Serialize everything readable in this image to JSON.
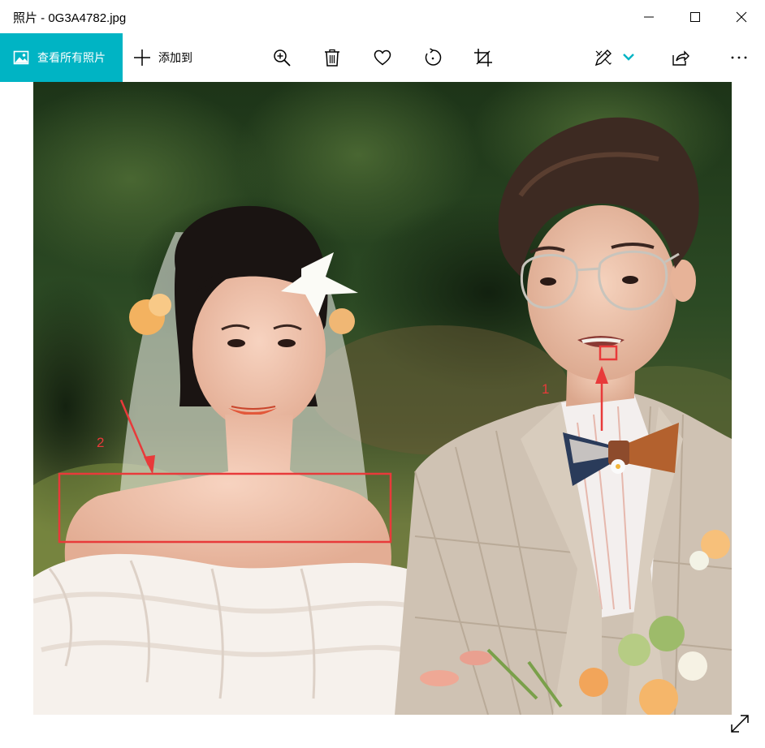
{
  "window": {
    "title": "照片 - 0G3A4782.jpg",
    "controls": [
      "minimize-icon",
      "maximize-icon",
      "close-icon"
    ]
  },
  "toolbar": {
    "all_photos_label": "查看所有照片",
    "add_to_label": "添加到",
    "icons": [
      "zoom-in-icon",
      "delete-icon",
      "favorite-icon",
      "rotate-icon",
      "crop-icon",
      "edit-icon",
      "chevron-down-icon",
      "share-icon",
      "more-icon"
    ]
  },
  "colors": {
    "accent": "#00b4c4",
    "annotation": "#e83a3a"
  },
  "annotations": [
    {
      "label": "1"
    },
    {
      "label": "2"
    }
  ]
}
